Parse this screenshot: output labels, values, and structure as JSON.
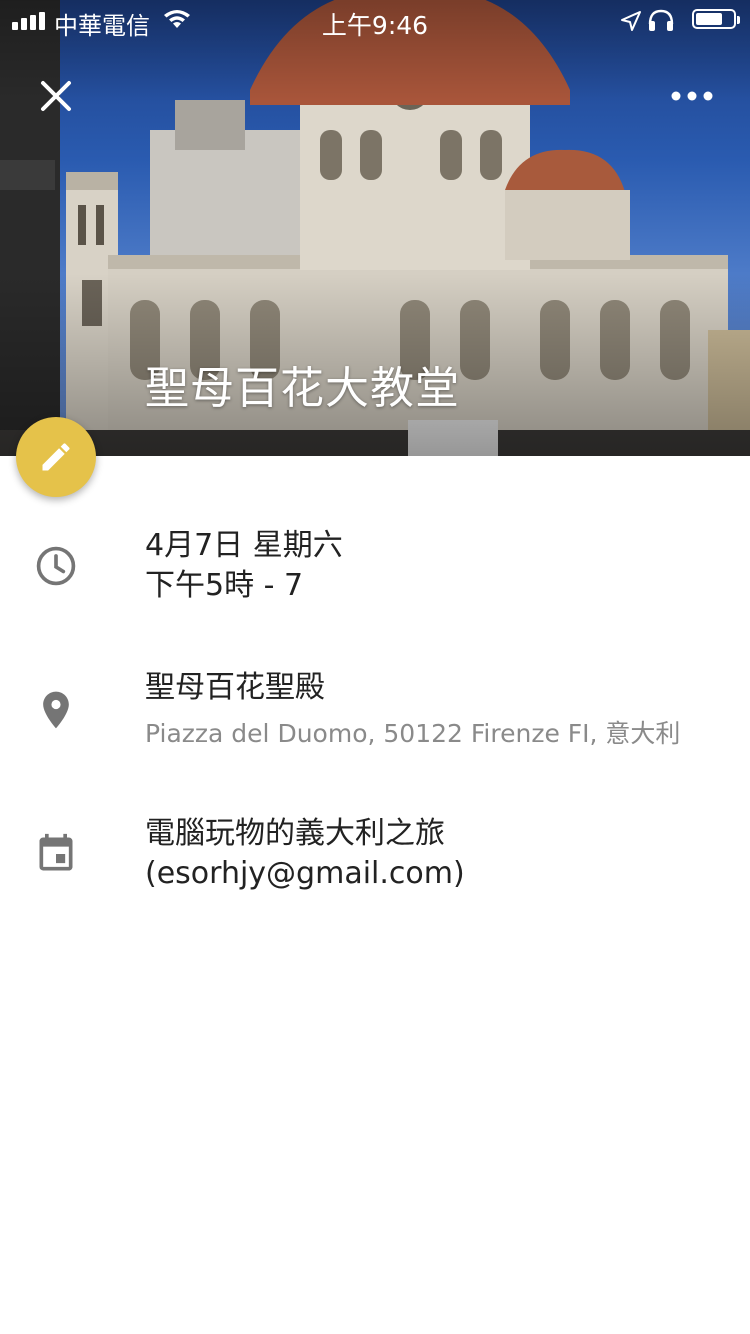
{
  "status_bar": {
    "carrier": "中華電信",
    "time": "上午9:46"
  },
  "event": {
    "title": "聖母百花大教堂"
  },
  "details": {
    "datetime_line1": "4月7日 星期六",
    "datetime_line2": "下午5時 - 7",
    "location_name": "聖母百花聖殿",
    "location_address": "Piazza del Duomo, 50122 Firenze FI, 意大利",
    "calendar_name": "電腦玩物的義大利之旅",
    "calendar_account": "(esorhjy@gmail.com)"
  },
  "icons": {
    "close": "close-icon",
    "more": "more-vert-icon",
    "edit": "pencil-icon",
    "time": "clock-icon",
    "location": "map-pin-icon",
    "calendar": "calendar-icon"
  },
  "colors": {
    "fab": "#e5c24a",
    "icon_gray": "#757575",
    "secondary_text": "#8a8a8a"
  }
}
